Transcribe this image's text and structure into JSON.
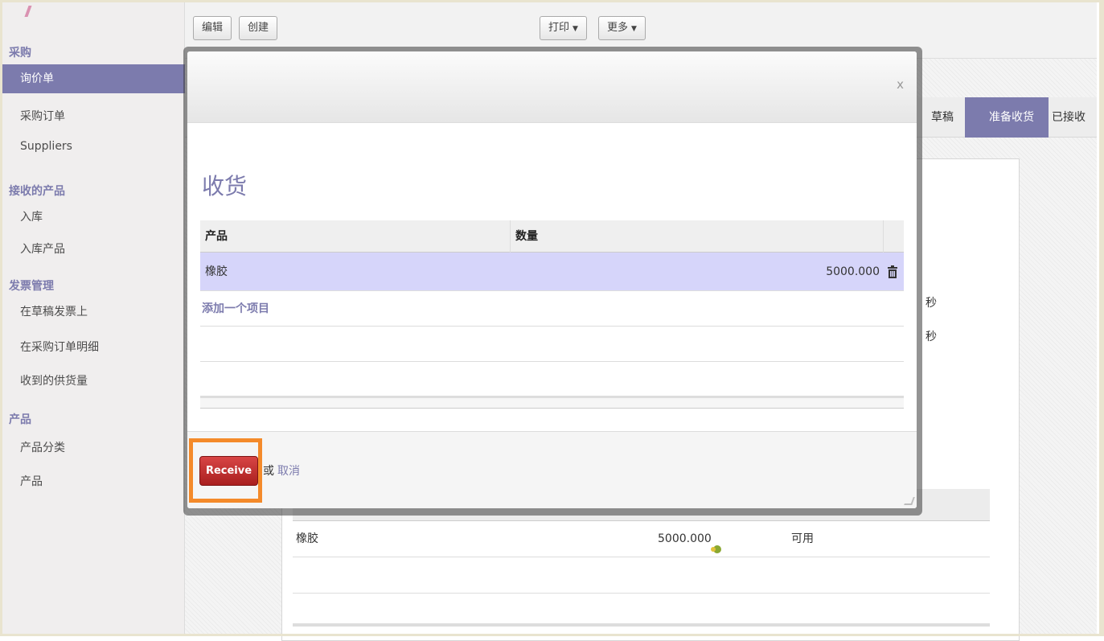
{
  "sidebar": {
    "sections": [
      {
        "title": "采购",
        "items": [
          "询价单",
          "采购订单",
          "Suppliers"
        ]
      },
      {
        "title": "接收的产品",
        "items": [
          "入库",
          "入库产品"
        ]
      },
      {
        "title": "发票管理",
        "items": [
          "在草稿发票上",
          "在采购订单明细",
          "收到的供货量"
        ]
      },
      {
        "title": "产品",
        "items": [
          "产品分类",
          "产品"
        ]
      }
    ],
    "active_item": "询价单"
  },
  "toolbar": {
    "edit_label": "编辑",
    "create_label": "创建",
    "print_label": "打印",
    "more_label": "更多"
  },
  "statusbar": {
    "stages": [
      "草稿",
      "准备收货",
      "已接收"
    ],
    "current": "准备收货"
  },
  "background": {
    "partial_texts": [
      "秒",
      "秒"
    ],
    "row": {
      "product": "橡胶",
      "quantity": "5000.000",
      "status": "可用"
    }
  },
  "modal": {
    "title": "收货",
    "close_glyph": "x",
    "columns": [
      "产品",
      "数量"
    ],
    "rows": [
      {
        "product": "橡胶",
        "quantity": "5000.000"
      }
    ],
    "add_item_label": "添加一个项目",
    "receive_label": "Receive",
    "or_text": "或",
    "cancel_label": "取消"
  },
  "colors": {
    "accent": "#7c7bad",
    "receive_button": "#c0392b",
    "highlight": "#f48a2a",
    "selected_row": "#d6d5fa"
  }
}
